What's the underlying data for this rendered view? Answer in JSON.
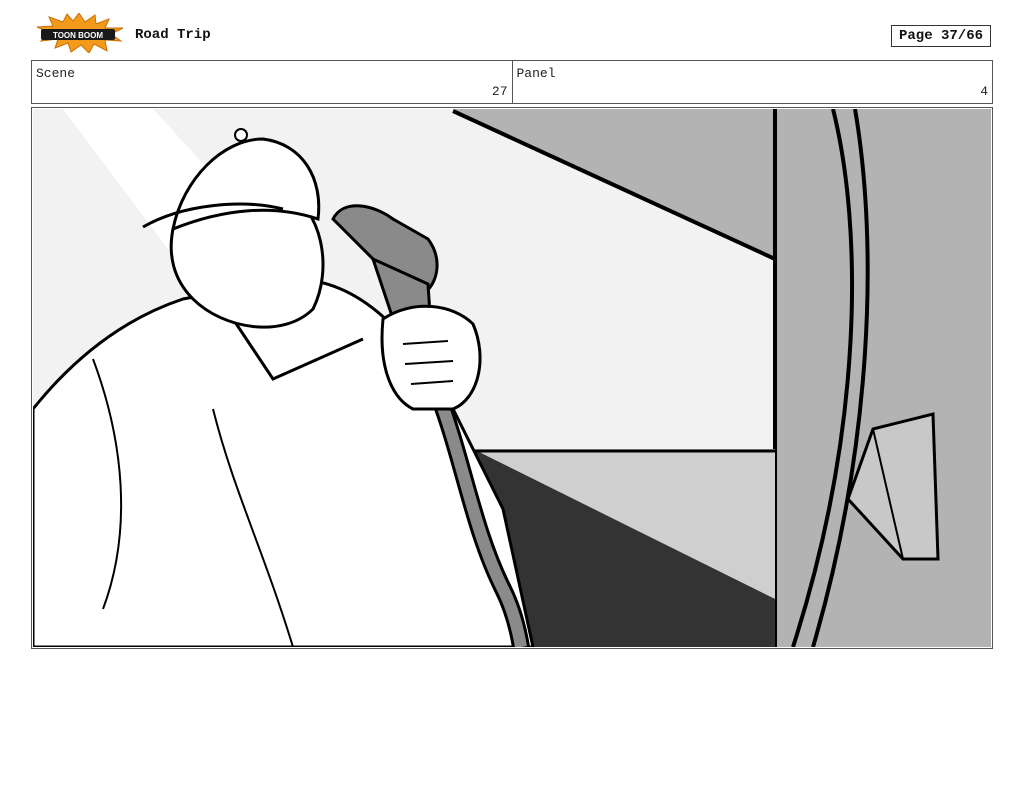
{
  "header": {
    "logo_text": "TOON BOOM",
    "title": "Road Trip",
    "page_label": "Page 37/66"
  },
  "info": {
    "scene_label": "Scene",
    "scene_value": "27",
    "panel_label": "Panel",
    "panel_value": "4"
  },
  "colors": {
    "logo_orange": "#f39a1c",
    "logo_dark": "#1a1a1a",
    "sky": "#f2f2f2",
    "truck_gray": "#b3b3b3",
    "shadow_dark": "#333333",
    "ground_light": "#cfcfcf",
    "nozzle_gray": "#8a8a8a"
  },
  "artwork": {
    "description_icon": "storyboard-sketch-fuel-attendant"
  }
}
